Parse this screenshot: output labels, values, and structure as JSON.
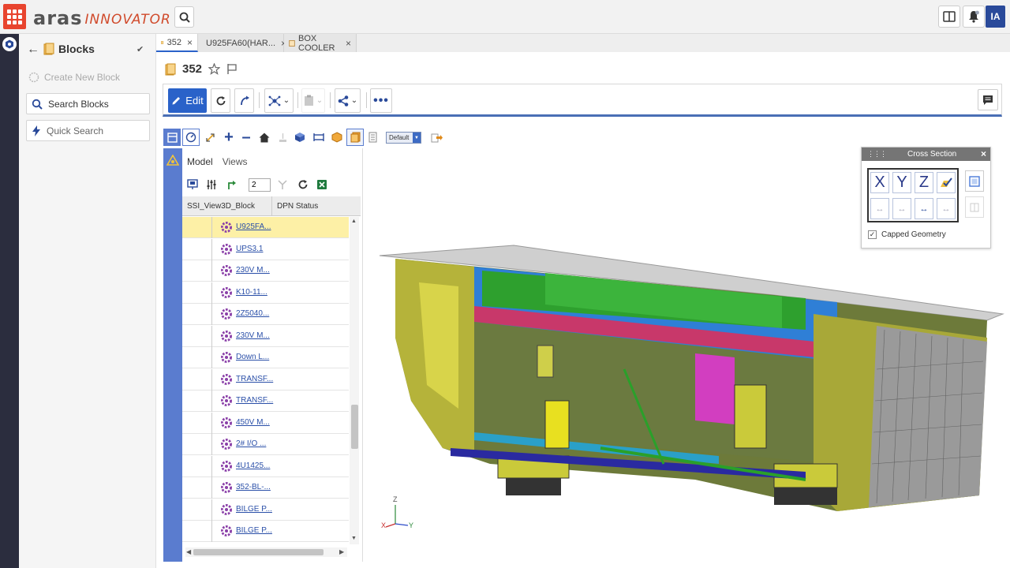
{
  "app": {
    "logo_main": "aras",
    "logo_sub": "INNOVATOR",
    "user_initials": "IA"
  },
  "blocks_panel": {
    "title": "Blocks",
    "create_label": "Create New Block",
    "search_label": "Search Blocks",
    "quick_search_label": "Quick Search"
  },
  "tabs": [
    {
      "label": "352"
    },
    {
      "label": "U925FA60(HAR..."
    },
    {
      "label": "BOX COOLER"
    }
  ],
  "item": {
    "title": "352"
  },
  "toolbar": {
    "edit_label": "Edit"
  },
  "viewer": {
    "view_select": "Default"
  },
  "tree": {
    "tab_model": "Model",
    "tab_views": "Views",
    "level_value": "2",
    "columns": [
      "SSI_View3D_Block",
      "DPN Status"
    ],
    "rows": [
      "U925FA...",
      "UPS3.1",
      "230V M...",
      "K10-11...",
      "2Z5040...",
      "230V M...",
      "Down L...",
      "TRANSF...",
      "TRANSF...",
      "450V M...",
      "2# I/O ...",
      "4U1425...",
      "352-BL-...",
      "BILGE P...",
      "BILGE P..."
    ]
  },
  "cross_section": {
    "title": "Cross Section",
    "x": "X",
    "y": "Y",
    "z": "Z",
    "capped_label": "Capped Geometry",
    "capped_checked": true
  },
  "axes": {
    "z": "Z",
    "x": "X",
    "y": "Y"
  },
  "colors": {
    "accent": "#2a62c9",
    "brand": "#e8442e",
    "tree_side": "#5a7ccf",
    "selected_row": "#fdf0a6"
  }
}
